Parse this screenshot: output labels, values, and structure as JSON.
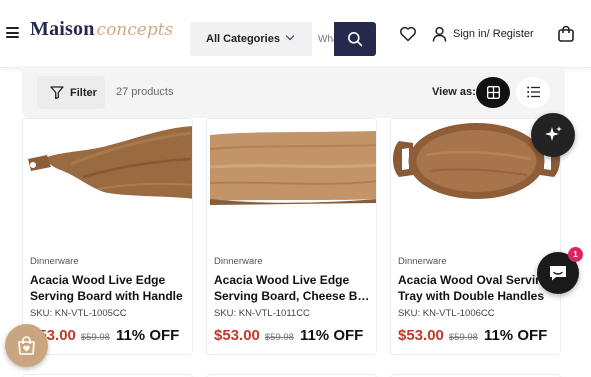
{
  "header": {
    "logo_main": "Maison",
    "logo_script": "concepts",
    "category_select": "All Categories",
    "search_placeholder": "What are you looking for?",
    "account_label": "Sign in/ Register"
  },
  "toolbar": {
    "filter_label": "Filter",
    "product_count": "27 products",
    "view_as_label": "View as:"
  },
  "products": [
    {
      "category": "Dinnerware",
      "title_line1": "Acacia Wood Live Edge",
      "title_line2": "Serving Board with Handle",
      "sku": "SKU: KN-VTL-1005CC",
      "price": "$53.00",
      "compare_price": "$59.98",
      "discount": "11% OFF"
    },
    {
      "category": "Dinnerware",
      "title_line1": "Acacia Wood Live Edge",
      "title_line2": "Serving Board, Cheese Board",
      "sku": "SKU: KN-VTL-1011CC",
      "price": "$53.00",
      "compare_price": "$59.98",
      "discount": "11% OFF"
    },
    {
      "category": "Dinnerware",
      "title_line1": "Acacia Wood Oval Serving",
      "title_line2": "Tray with Double Handles",
      "sku": "SKU: KN-VTL-1006CC",
      "price": "$53.00",
      "compare_price": "$59.98",
      "discount": "11% OFF"
    }
  ],
  "chat": {
    "badge_count": "1"
  },
  "colors": {
    "brand_navy": "#25294e",
    "logo_gold": "#d3a983",
    "sale_red": "#c0392b",
    "wishlist_tan": "#c9a67f",
    "badge_pink": "#e0245e"
  }
}
